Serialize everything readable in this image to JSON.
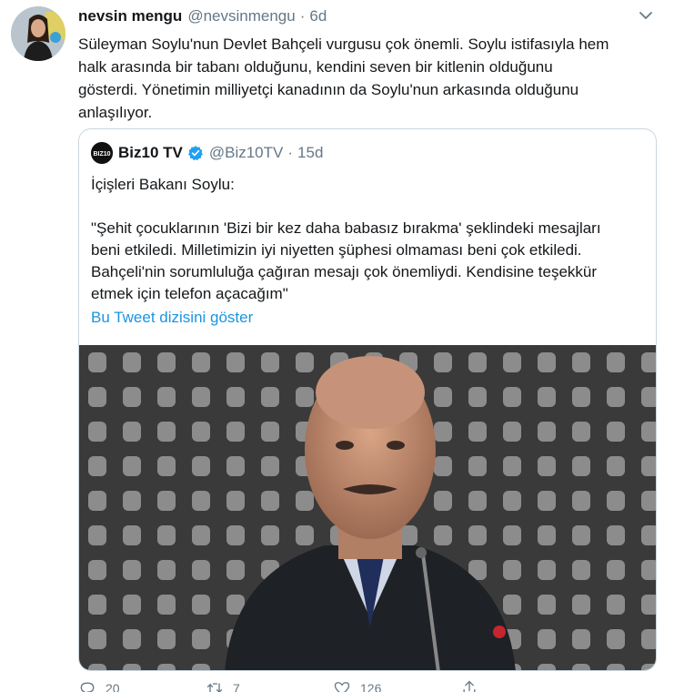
{
  "tweet": {
    "author_name": "nevsin mengu",
    "author_handle": "@nevsinmengu",
    "separator": "·",
    "time": "6d",
    "text_lines": [
      "Süleyman Soylu'nun Devlet Bahçeli vurgusu çok önemli. Soylu istifasıyla hem",
      "halk arasında bir tabanı olduğunu, kendini seven bir kitlenin olduğunu",
      "gösterdi. Yönetimin milliyetçi kanadının da Soylu'nun arkasında olduğunu",
      "anlaşılıyor."
    ]
  },
  "quote": {
    "logo_text": "BIZ10",
    "author_name": "Biz10 TV",
    "author_handle": "@Biz10TV",
    "separator": "·",
    "time": "15d",
    "first_line": "İçişleri Bakanı Soylu:",
    "body_lines": [
      "\"Şehit çocuklarının 'Bizi bir kez daha babasız bırakma' şeklindeki mesajları",
      "beni etkiledi. Milletimizin iyi niyetten şüphesi olmaması beni çok etkiledi.",
      "Bahçeli'nin sorumluluğa çağıran mesajı çok önemliydi. Kendisine teşekkür",
      "etmek için telefon açacağım\""
    ],
    "thread_link": "Bu Tweet dizisini göster"
  },
  "actions": {
    "reply_count": "20",
    "retweet_count": "7",
    "like_count": "126"
  },
  "colors": {
    "link": "#1b95e0",
    "secondary_text": "#657786",
    "border": "#ccd6dd",
    "verified": "#1da1f2"
  },
  "icons": [
    "caret-down-icon",
    "verified-badge-icon",
    "reply-icon",
    "retweet-icon",
    "like-icon",
    "share-icon"
  ]
}
